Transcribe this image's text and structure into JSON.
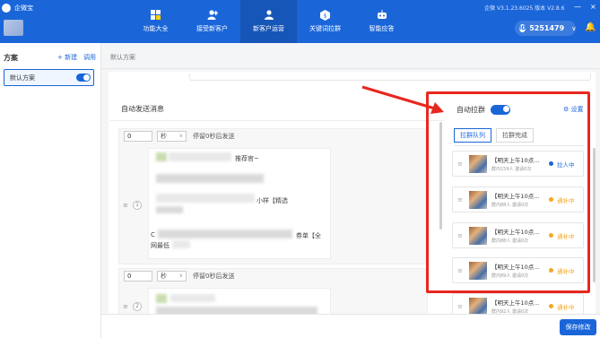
{
  "app": {
    "title": "企微宝",
    "version": "企微 V3.1.23.6025 版本 V2.8.6",
    "win_controls": [
      "—",
      "×"
    ]
  },
  "nav": [
    {
      "label": "功能大全",
      "icon": "grid-icon"
    },
    {
      "label": "接受新客户",
      "icon": "user-add-icon"
    },
    {
      "label": "新客户运营",
      "icon": "user-icon"
    },
    {
      "label": "关键词拉群",
      "icon": "hexagon-icon"
    },
    {
      "label": "智能应答",
      "icon": "robot-icon"
    }
  ],
  "account": {
    "id": "5251479"
  },
  "sidebar": {
    "title": "方案",
    "new_label": "+ 新建",
    "import_label": "调用",
    "scheme": "默认方案"
  },
  "breadcrumb": "默认方案",
  "auto_send": {
    "title": "自动发送消息",
    "blocks": [
      {
        "num": "0",
        "unit": "秒",
        "after_text": "停留0秒后发送",
        "step": "1",
        "fragments": [
          "推荐官~",
          "小样【精选",
          "券单【全",
          "网最低",
          "C"
        ]
      },
      {
        "num": "0",
        "unit": "秒",
        "after_text": "停留0秒后发送",
        "step": "2",
        "fragments": []
      }
    ]
  },
  "auto_group": {
    "title": "自动拉群",
    "settings": "设置",
    "tabs": [
      "拉群队列",
      "拉群完成"
    ],
    "cards": [
      {
        "name": "【明天上午10点...",
        "meta": "群内159人 邀请0次",
        "status": "拉人中",
        "status_color": "#1a66d9"
      },
      {
        "name": "【明天上午10点...",
        "meta": "群内88人 邀请0次",
        "status": "通补中",
        "status_color": "#f5a623"
      },
      {
        "name": "【明天上午10点...",
        "meta": "群内88人 邀请0次",
        "status": "通补中",
        "status_color": "#f5a623"
      },
      {
        "name": "【明天上午10点...",
        "meta": "群内89人 邀请0次",
        "status": "通补中",
        "status_color": "#f5a623"
      },
      {
        "name": "【明天上午10点...",
        "meta": "群内92人 邀请0次",
        "status": "通补中",
        "status_color": "#f5a623"
      }
    ]
  },
  "save_label": "保存修改",
  "colors": {
    "brand": "#1a66d9",
    "highlight": "#e8271f",
    "pending": "#f5a623"
  }
}
